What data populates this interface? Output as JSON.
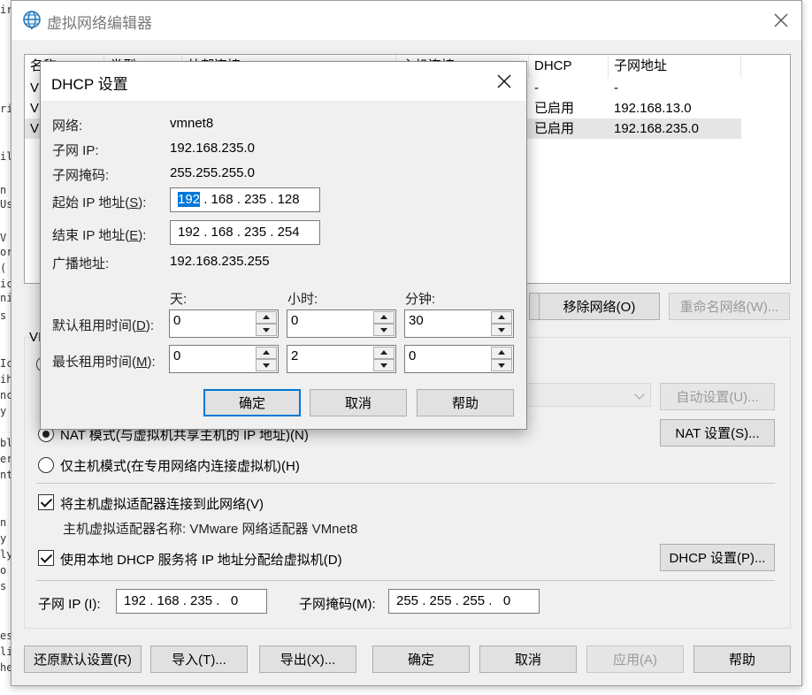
{
  "background": {
    "fragments": [
      "ir",
      "ri",
      "il",
      "n",
      "Us",
      "V",
      "or",
      "(",
      "ic",
      "ni",
      "s",
      "Ic",
      "ih",
      "nc",
      "y",
      "bl",
      "er",
      "nt",
      "n",
      "y",
      "ly",
      "o",
      "s",
      "es",
      "li",
      "he"
    ]
  },
  "main_window": {
    "title": "虚拟网络编辑器",
    "table": {
      "headers": [
        "名称",
        "类型",
        "外部连接",
        "主机连接",
        "DHCP",
        "子网地址"
      ],
      "rows": [
        {
          "name": "VI",
          "dhcp": "-",
          "subnet": "-"
        },
        {
          "name": "VI",
          "dhcp": "已启用",
          "subnet": "192.168.13.0"
        },
        {
          "name": "VI",
          "dhcp": "已启用",
          "subnet": "192.168.235.0"
        }
      ]
    },
    "remove_network": "移除网络(O)",
    "rename_network": "重命名网络(W)...",
    "group_label": "VI",
    "auto_settings": "自动设置(U)...",
    "nat_mode": "NAT 模式(与虚拟机共享主机的 IP 地址)(N)",
    "nat_settings": "NAT 设置(S)...",
    "host_only": "仅主机模式(在专用网络内连接虚拟机)(H)",
    "connect_adapter": "将主机虚拟适配器连接到此网络(V)",
    "adapter_name": "主机虚拟适配器名称: VMware 网络适配器 VMnet8",
    "use_dhcp": "使用本地 DHCP 服务将 IP 地址分配给虚拟机(D)",
    "dhcp_settings": "DHCP 设置(P)...",
    "subnet_ip_label": "子网 IP (I):",
    "subnet_ip": "192 . 168 . 235 .   0",
    "subnet_mask_label": "子网掩码(M):",
    "subnet_mask": "255 . 255 . 255 .   0",
    "buttons": {
      "restore": "还原默认设置(R)",
      "import": "导入(T)...",
      "export": "导出(X)...",
      "ok": "确定",
      "cancel": "取消",
      "apply": "应用(A)",
      "help": "帮助"
    }
  },
  "dhcp_dialog": {
    "title": "DHCP 设置",
    "network_label": "网络:",
    "network": "vmnet8",
    "subnet_ip_label": "子网 IP:",
    "subnet_ip": "192.168.235.0",
    "mask_label": "子网掩码:",
    "mask": "255.255.255.0",
    "start_ip_label_pre": "起始 IP 地址(",
    "start_ip_key": "S",
    "start_ip_first": "192",
    "start_ip_rest": " . 168 . 235 . 128",
    "end_ip_label_pre": "结束 IP 地址(",
    "end_ip_key": "E",
    "end_ip": "192 . 168 . 235 . 254",
    "broadcast_label": "广播地址:",
    "broadcast": "192.168.235.255",
    "col_days": "天:",
    "col_hours": "小时:",
    "col_minutes": "分钟:",
    "default_lease_pre": "默认租用时间(",
    "default_lease_key": "D",
    "default_lease": {
      "days": "0",
      "hours": "0",
      "minutes": "30"
    },
    "max_lease_pre": "最长租用时间(",
    "max_lease_key": "M",
    "max_lease": {
      "days": "0",
      "hours": "2",
      "minutes": "0"
    },
    "label_close": "):",
    "ok": "确定",
    "cancel": "取消",
    "help": "帮助"
  }
}
